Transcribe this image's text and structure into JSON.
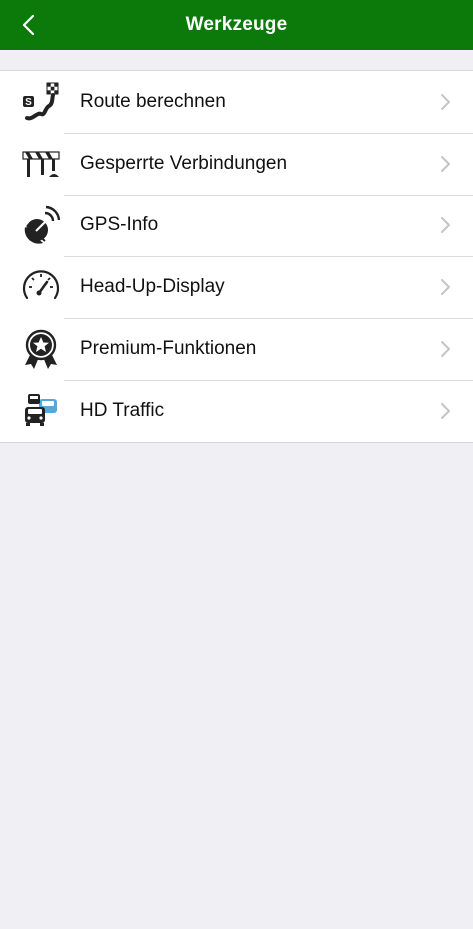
{
  "header": {
    "title": "Werkzeuge",
    "back_icon": "chevron-left-icon",
    "background": "#0b7a0b"
  },
  "menu": {
    "items": [
      {
        "label": "Route berechnen",
        "icon": "route-calc-icon"
      },
      {
        "label": "Gesperrte Verbindungen",
        "icon": "road-barrier-icon"
      },
      {
        "label": "GPS-Info",
        "icon": "satellite-dish-icon"
      },
      {
        "label": "Head-Up-Display",
        "icon": "speedometer-icon"
      },
      {
        "label": "Premium-Funktionen",
        "icon": "award-star-icon"
      },
      {
        "label": "HD Traffic",
        "icon": "traffic-cars-icon"
      }
    ]
  }
}
